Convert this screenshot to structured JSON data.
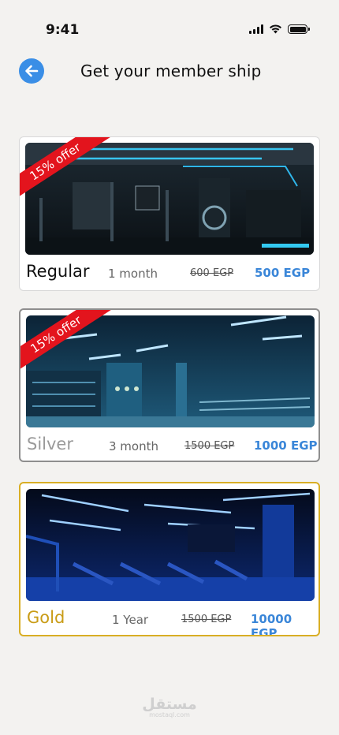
{
  "status_bar": {
    "time": "9:41",
    "icons": [
      "signal-icon",
      "wifi-icon",
      "battery-icon"
    ]
  },
  "header": {
    "back_icon": "arrow-left-icon",
    "title": "Get your member ship"
  },
  "plans": [
    {
      "name": "Regular",
      "duration": "1 month",
      "old_price": "600 EGP",
      "new_price": "500 EGP",
      "badge": "15% offer"
    },
    {
      "name": "Silver",
      "duration": "3 month",
      "old_price": "1500 EGP",
      "new_price": "1000 EGP",
      "badge": "15% offer"
    },
    {
      "name": "Gold",
      "duration": "1 Year",
      "old_price": "1500 EGP",
      "new_price": "10000 EGP"
    }
  ],
  "watermark": {
    "main": "مستقل",
    "sub": "mostaql.com"
  },
  "colors": {
    "accent": "#3a86d8",
    "offer": "#e3141d",
    "gold": "#c99c16",
    "silver": "#9a9a9a"
  }
}
